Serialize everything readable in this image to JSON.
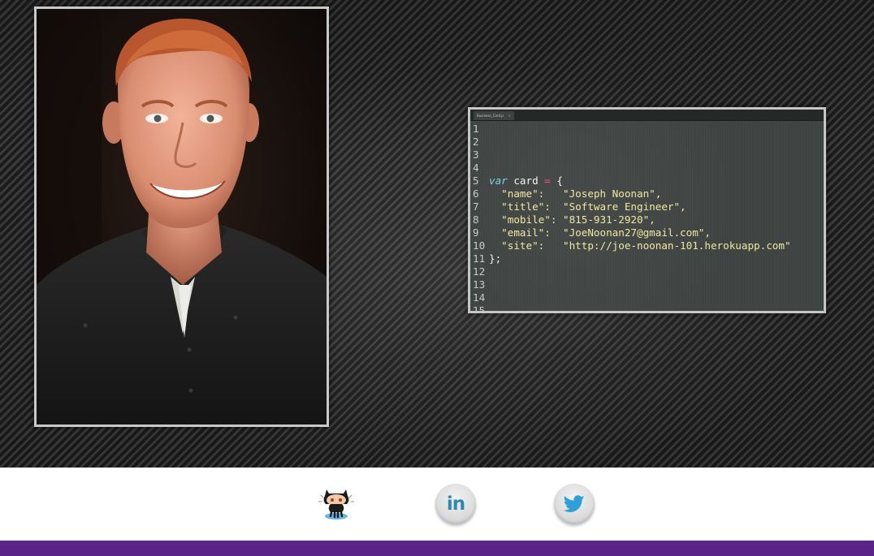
{
  "profile": {
    "photo_icon": "portrait-photo"
  },
  "code_card": {
    "tab_label": "Business_Card.js",
    "tab_close": "×",
    "lines": [
      {
        "num": "1",
        "text": ""
      },
      {
        "num": "2",
        "text": ""
      },
      {
        "num": "3",
        "text": ""
      },
      {
        "num": "4",
        "text": ""
      },
      {
        "num": "5",
        "keyword": "var",
        "ident": " card ",
        "op": "=",
        "rest": " {"
      },
      {
        "num": "6",
        "key": "  \"name\":   ",
        "value": "\"Joseph Noonan\","
      },
      {
        "num": "7",
        "key": "  \"title\":  ",
        "value": "\"Software Engineer\","
      },
      {
        "num": "8",
        "key": "  \"mobile\": ",
        "value": "\"815-931-2920\","
      },
      {
        "num": "9",
        "key": "  \"email\":  ",
        "value": "\"JoeNoonan27@gmail.com\","
      },
      {
        "num": "10",
        "key": "  \"site\":   ",
        "value": "\"http://joe-noonan-101.herokuapp.com\""
      },
      {
        "num": "11",
        "text": "};"
      },
      {
        "num": "12",
        "text": ""
      },
      {
        "num": "13",
        "text": ""
      },
      {
        "num": "14",
        "text": ""
      },
      {
        "num": "15",
        "text": ""
      }
    ]
  },
  "social": {
    "github": {
      "icon": "github-octocat-icon"
    },
    "linkedin": {
      "icon": "linkedin-icon",
      "label": "in",
      "color": "#2f87b7"
    },
    "twitter": {
      "icon": "twitter-bird-icon",
      "color": "#2f9fd8"
    }
  },
  "colors": {
    "footer": "#5a2388",
    "hero_dark": "#1b1b1b",
    "hero_stripe": "#3c3c3c"
  }
}
